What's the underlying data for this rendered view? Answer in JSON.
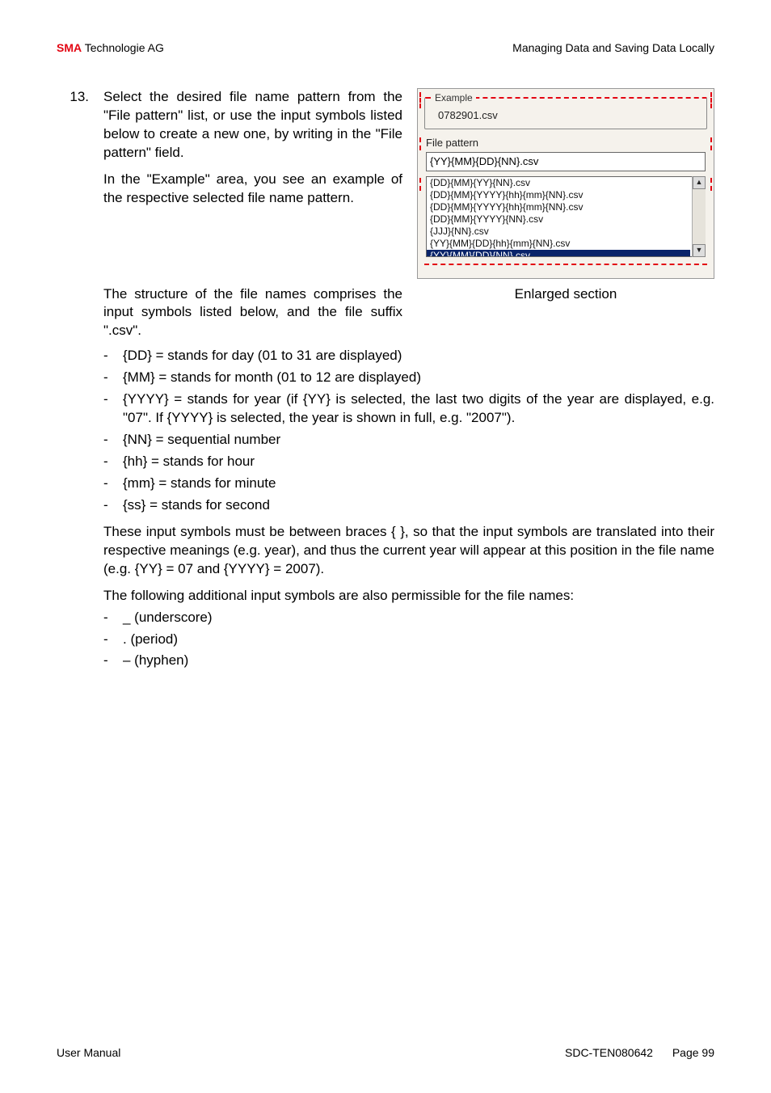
{
  "header": {
    "brand": "SMA",
    "brand_suffix": " Technologie AG",
    "right": "Managing Data and Saving Data Locally"
  },
  "step": {
    "number": "13.",
    "p1": "Select the desired file name pattern from the \"File pattern\" list, or use the input symbols listed below to create a new one, by writing in the \"File pattern\" field.",
    "p2": "In the \"Example\" area, you see an example of the respective selected file name pattern."
  },
  "figure": {
    "example_label": "Example",
    "example_value": "0782901.csv",
    "file_pattern_label": "File pattern",
    "file_pattern_value": "{YY}{MM}{DD}{NN}.csv",
    "list": [
      "{DD}{MM}{YY}{NN}.csv",
      "{DD}{MM}{YYYY}{hh}{mm}{NN}.csv",
      "{DD}{MM}{YYYY}{hh}{mm}{NN}.csv",
      "{DD}{MM}{YYYY}{NN}.csv",
      "{JJJ}{NN}.csv",
      "{YY}{MM}{DD}{hh}{mm}{NN}.csv",
      "{YY}{MM}{DD}{NN}.csv"
    ],
    "caption": "Enlarged section"
  },
  "after_fig": "The structure of the file names comprises the input symbols listed below, and the file suffix \".csv\".",
  "symbols": [
    "{DD} = stands for day (01 to 31 are displayed)",
    "{MM} = stands for month (01 to 12 are displayed)",
    "{YYYY} = stands for year (if {YY} is selected, the last two digits of the year are displayed, e.g. \"07\". If {YYYY} is selected, the year is shown in full, e.g. \"2007\").",
    "{NN} = sequential number",
    "{hh} = stands for hour",
    "{mm} = stands for minute",
    "{ss} = stands for second"
  ],
  "para2": "These input symbols must be between braces { }, so that the input symbols are translated into their respective meanings (e.g. year), and thus the current year will appear at this position in the file name (e.g. {YY} = 07 and {YYYY} = 2007).",
  "para3": "The following additional input symbols are also permissible for the file names:",
  "extras": [
    "_ (underscore)",
    ". (period)",
    "– (hyphen)"
  ],
  "footer": {
    "left": "User Manual",
    "doc": "SDC-TEN080642",
    "page_label": "Page 99"
  }
}
